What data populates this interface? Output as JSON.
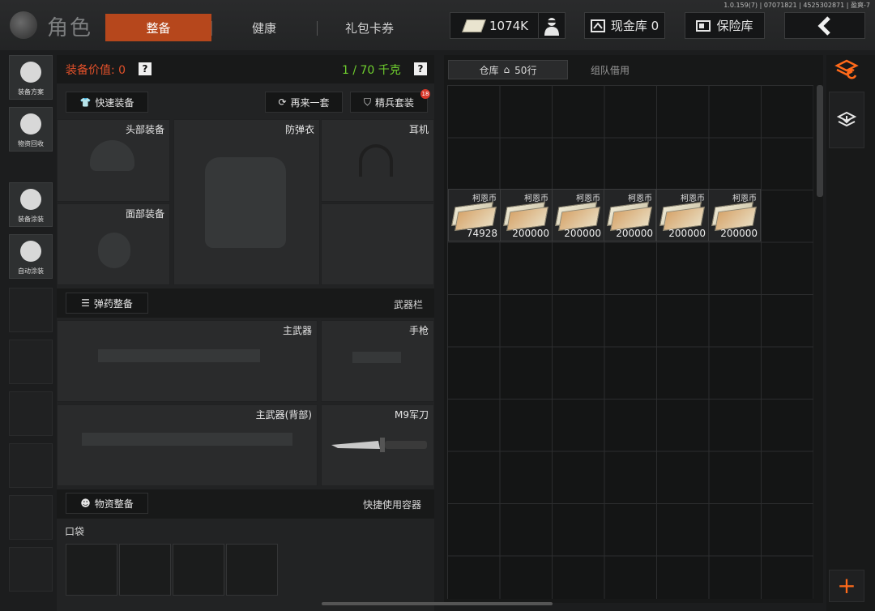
{
  "version": "1.0.159(7) | 07071821 | 4525302871 | 盈爽-7",
  "header": {
    "title": "角色",
    "tabs": [
      {
        "label": "整备",
        "active": true
      },
      {
        "label": "健康",
        "active": false
      },
      {
        "label": "礼包卡券",
        "active": false
      }
    ],
    "money": "1074K",
    "cash_button": "现金库 0",
    "safe_button": "保险库"
  },
  "sidebar": [
    {
      "label": "装备方案",
      "icon": "helmet-icon"
    },
    {
      "label": "物资回收",
      "icon": "recycle-icon"
    },
    {
      "label": "装备涂装",
      "icon": "paint-helmet-icon"
    },
    {
      "label": "自动涂装",
      "icon": "brush-icon"
    }
  ],
  "equipment": {
    "value_label": "装备价值: 0",
    "weight": "1 / 70 千克",
    "help": "?",
    "quick_equip": "快速装备",
    "again": "再来一套",
    "elite_kit": "精兵套装",
    "elite_badge": "18",
    "slots": {
      "head": "头部装备",
      "armor": "防弹衣",
      "headset": "耳机",
      "face": "面部装备"
    },
    "ammo_button": "弹药整备",
    "weapons_title": "武器栏",
    "weapon_slots": {
      "primary": "主武器",
      "pistol": "手枪",
      "primary_back": "主武器(背部)",
      "knife": "M9军刀"
    },
    "supply_button": "物资整备",
    "quick_container": "快捷使用容器",
    "pocket": "口袋"
  },
  "warehouse": {
    "tab_storage": "仓库",
    "rows": "50行",
    "tab_team": "组队借用",
    "items": [
      {
        "name": "柯恩币",
        "amount": "74928"
      },
      {
        "name": "柯恩币",
        "amount": "200000"
      },
      {
        "name": "柯恩币",
        "amount": "200000"
      },
      {
        "name": "柯恩币",
        "amount": "200000"
      },
      {
        "name": "柯恩币",
        "amount": "200000"
      },
      {
        "name": "柯恩币",
        "amount": "200000"
      }
    ]
  },
  "colors": {
    "accent": "#b6471c",
    "value_red": "#e0502a",
    "weight_green": "#6fcf2e",
    "add_orange": "#ff6a1a"
  }
}
